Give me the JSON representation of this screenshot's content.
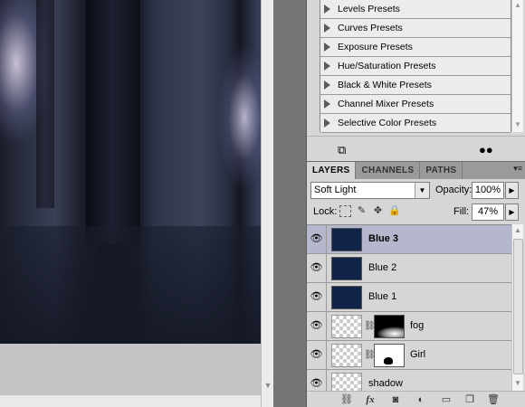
{
  "presets": {
    "items": [
      "Levels Presets",
      "Curves Presets",
      "Exposure Presets",
      "Hue/Saturation Presets",
      "Black & White Presets",
      "Channel Mixer Presets",
      "Selective Color Presets"
    ],
    "footer_icons": [
      "clip-to-layer-icon",
      "visibility-toggle-icon"
    ]
  },
  "layers_panel": {
    "tabs": [
      {
        "label": "LAYERS",
        "active": true
      },
      {
        "label": "CHANNELS",
        "active": false
      },
      {
        "label": "PATHS",
        "active": false
      }
    ],
    "blend_mode": "Soft Light",
    "opacity_label": "Opacity:",
    "opacity_value": "100%",
    "lock_label": "Lock:",
    "fill_label": "Fill:",
    "fill_value": "47%",
    "layers": [
      {
        "name": "Blue 3",
        "thumb": "navy",
        "selected": true
      },
      {
        "name": "Blue 2",
        "thumb": "navy",
        "selected": false
      },
      {
        "name": "Blue 1",
        "thumb": "navy",
        "selected": false
      },
      {
        "name": "fog",
        "thumb": "checker",
        "mask": "fog",
        "selected": false
      },
      {
        "name": "Girl",
        "thumb": "checker",
        "mask": "girl",
        "selected": false
      },
      {
        "name": "shadow",
        "thumb": "checker",
        "selected": false
      }
    ],
    "footer_icons": [
      "link-layers-icon",
      "fx-icon",
      "add-mask-icon",
      "adjustment-layer-icon",
      "new-group-icon",
      "new-layer-icon",
      "trash-icon"
    ],
    "colors": {
      "navy_thumb": "#0f2447",
      "selected_row": "#b5b8cc"
    }
  }
}
